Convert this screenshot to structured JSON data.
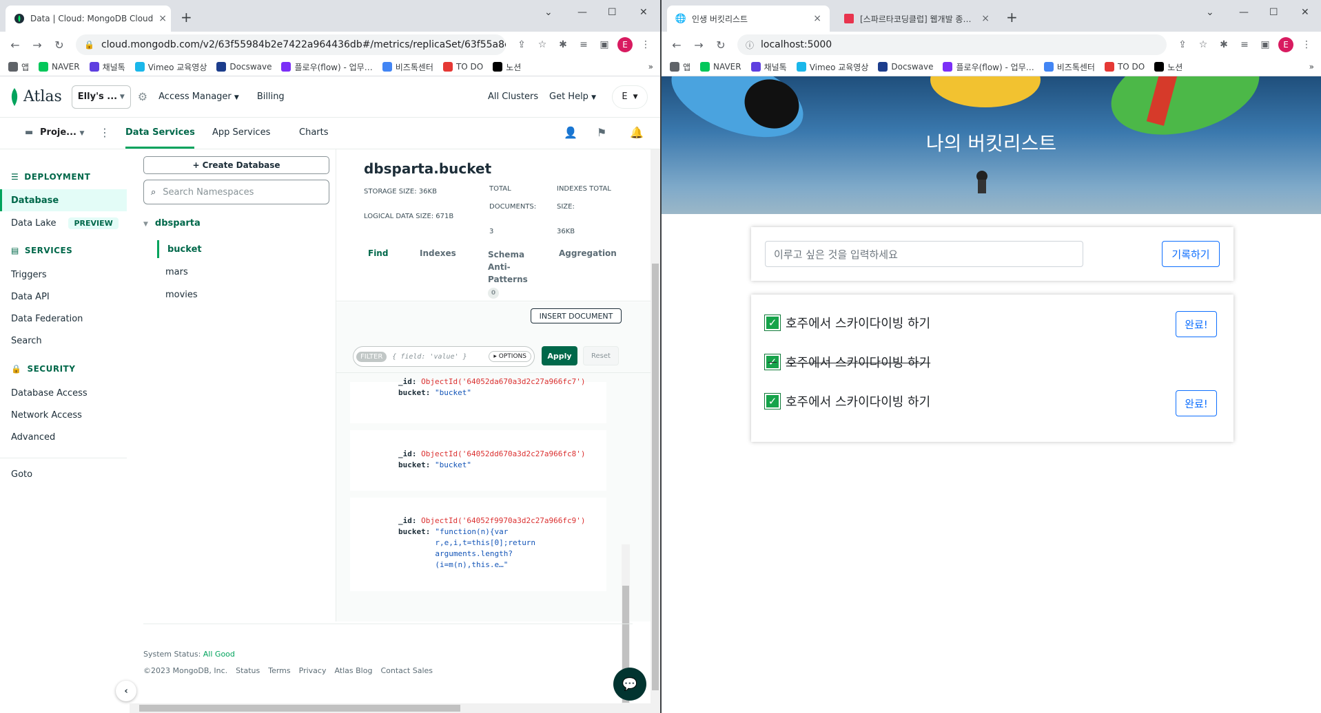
{
  "left": {
    "tab": {
      "title": "Data | Cloud: MongoDB Cloud",
      "close": "×"
    },
    "new_tab": "+",
    "url": "cloud.mongodb.com/v2/63f55984b2e7422a964436db#/metrics/replicaSet/63f55a8d76c8…",
    "profile_initial": "E",
    "bookmarks": [
      {
        "label": "앱",
        "color": "#5f6368"
      },
      {
        "label": "NAVER",
        "color": "#03c75a"
      },
      {
        "label": "채널톡",
        "color": "#5e3fe0"
      },
      {
        "label": "Vimeo 교육영상",
        "color": "#1ab7ea"
      },
      {
        "label": "Docswave",
        "color": "#1c3d8c"
      },
      {
        "label": "플로우(flow) - 업무…",
        "color": "#7b2ff7"
      },
      {
        "label": "비즈톡센터",
        "color": "#4285f4"
      },
      {
        "label": "TO DO",
        "color": "#e53935"
      },
      {
        "label": "노션",
        "color": "#000000"
      }
    ],
    "bookmarks_more": "»",
    "atlas": {
      "logo": "Atlas",
      "org": "Elly's ...",
      "access_manager": "Access Manager",
      "billing": "Billing",
      "all_clusters": "All Clusters",
      "get_help": "Get Help",
      "user_initial": "E",
      "project": "Proje...",
      "nav_tabs": [
        "Data Services",
        "App Services",
        "Charts"
      ],
      "sidebar": {
        "deployment": "DEPLOYMENT",
        "database": "Database",
        "data_lake": "Data Lake",
        "preview": "PREVIEW",
        "services": "SERVICES",
        "triggers": "Triggers",
        "data_api": "Data API",
        "data_federation": "Data Federation",
        "search": "Search",
        "security": "SECURITY",
        "database_access": "Database Access",
        "network_access": "Network Access",
        "advanced": "Advanced",
        "goto": "Goto"
      },
      "create_db": "+ Create Database",
      "search_ns_placeholder": "Search Namespaces",
      "db_name": "dbsparta",
      "collections": [
        "bucket",
        "mars",
        "movies"
      ],
      "detail": {
        "title": "dbsparta.bucket",
        "storage": "STORAGE SIZE: 36KB",
        "logical": "LOGICAL DATA SIZE: 671B",
        "total_docs_label1": "TOTAL",
        "total_docs_label2": "DOCUMENTS:",
        "total_docs": "3",
        "indexes_label1": "INDEXES TOTAL",
        "indexes_label2": "SIZE:",
        "indexes_total": "36KB",
        "tabs": [
          "Find",
          "Indexes",
          "Schema Anti-Patterns",
          "Aggregation"
        ],
        "schema_badge": "0",
        "insert_btn": "INSERT DOCUMENT",
        "filter_badge": "FILTER",
        "filter_placeholder": "{ field: 'value' }",
        "options": "▸ OPTIONS",
        "apply": "Apply",
        "reset": "Reset",
        "docs": [
          {
            "id_key": "_id:",
            "id_val": "ObjectId('64052da670a3d2c27a966fc7')",
            "b_key": "bucket:",
            "b_val": "\"bucket\""
          },
          {
            "id_key": "_id:",
            "id_val": "ObjectId('64052dd670a3d2c27a966fc8')",
            "b_key": "bucket:",
            "b_val": "\"bucket\""
          },
          {
            "id_key": "_id:",
            "id_val": "ObjectId('64052f9970a3d2c27a966fc9')",
            "b_key": "bucket:",
            "b_val_lines": [
              "\"function(n){var",
              "r,e,i,t=this[0];return",
              "arguments.length?",
              "(i=m(n),this.e…\""
            ]
          }
        ]
      },
      "footer": {
        "status_label": "System Status:",
        "status_value": "All Good",
        "copyright": "©2023 MongoDB, Inc.",
        "links": [
          "Status",
          "Terms",
          "Privacy",
          "Atlas Blog",
          "Contact Sales"
        ]
      }
    }
  },
  "right": {
    "tabs": [
      {
        "title": "인생 버킷리스트",
        "close": "×"
      },
      {
        "title": "[스파르타코딩클럽] 웹개발 종합…",
        "close": "×"
      }
    ],
    "new_tab": "+",
    "url": "localhost:5000",
    "profile_initial": "E",
    "bookmarks": [
      {
        "label": "앱",
        "color": "#5f6368"
      },
      {
        "label": "NAVER",
        "color": "#03c75a"
      },
      {
        "label": "채널톡",
        "color": "#5e3fe0"
      },
      {
        "label": "Vimeo 교육영상",
        "color": "#1ab7ea"
      },
      {
        "label": "Docswave",
        "color": "#1c3d8c"
      },
      {
        "label": "플로우(flow) - 업무…",
        "color": "#7b2ff7"
      },
      {
        "label": "비즈톡센터",
        "color": "#4285f4"
      },
      {
        "label": "TO DO",
        "color": "#e53935"
      },
      {
        "label": "노션",
        "color": "#000000"
      }
    ],
    "bookmarks_more": "»",
    "page": {
      "title": "나의 버킷리스트",
      "input_placeholder": "이루고 싶은 것을 입력하세요",
      "record_btn": "기록하기",
      "items": [
        {
          "text": "호주에서 스카이다이빙 하기",
          "done": false,
          "btn": "완료!"
        },
        {
          "text": "호주에서 스카이다이빙 하기",
          "done": true
        },
        {
          "text": "호주에서 스카이다이빙 하기",
          "done": false,
          "btn": "완료!"
        }
      ]
    }
  }
}
